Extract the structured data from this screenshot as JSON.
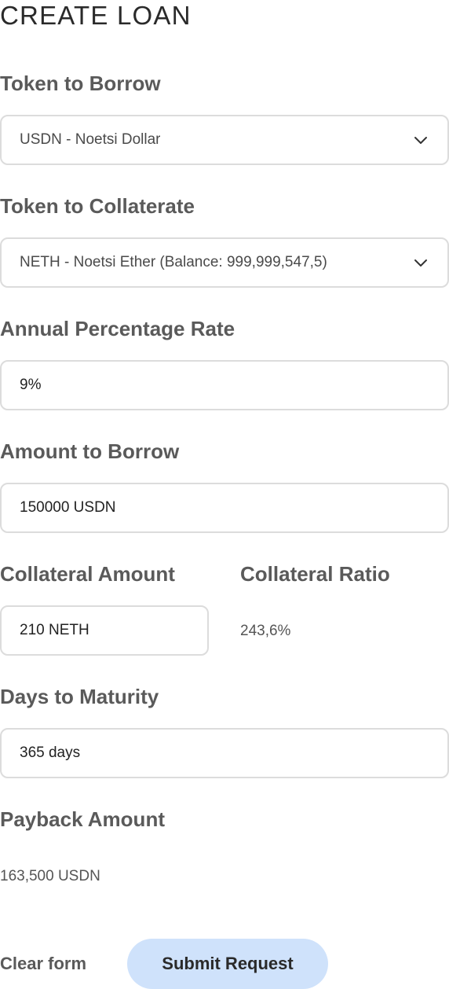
{
  "header": {
    "title": "CREATE LOAN"
  },
  "form": {
    "token_to_borrow": {
      "label": "Token to Borrow",
      "selected": "USDN - Noetsi Dollar"
    },
    "token_to_collaterate": {
      "label": "Token to Collaterate",
      "selected": "NETH - Noetsi Ether (Balance: 999,999,547,5)"
    },
    "annual_percentage_rate": {
      "label": "Annual Percentage Rate",
      "value": "9%"
    },
    "amount_to_borrow": {
      "label": "Amount to Borrow",
      "value": "150000 USDN"
    },
    "collateral_amount": {
      "label": "Collateral Amount",
      "value": "210 NETH"
    },
    "collateral_ratio": {
      "label": "Collateral Ratio",
      "value": "243,6%"
    },
    "days_to_maturity": {
      "label": "Days to Maturity",
      "value": "365 days"
    },
    "payback_amount": {
      "label": "Payback Amount",
      "value": "163,500 USDN"
    }
  },
  "actions": {
    "clear_label": "Clear form",
    "submit_label": "Submit Request"
  },
  "icons": {
    "select_chevron": "chevron-down-icon"
  },
  "colors": {
    "submit_background": "#cfe2fb",
    "field_border": "#dcdcdc",
    "label_text": "#5a5a5a"
  }
}
